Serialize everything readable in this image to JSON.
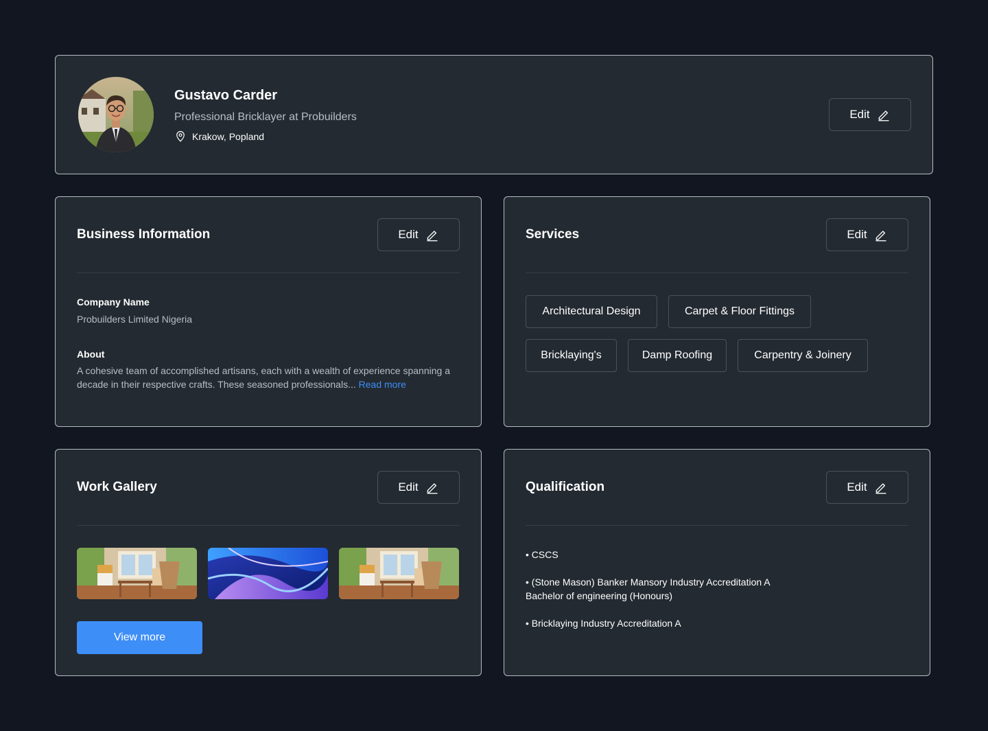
{
  "profile": {
    "name": "Gustavo Carder",
    "title": "Professional Bricklayer at Probuilders",
    "location": "Krakow, Popland",
    "edit_label": "Edit"
  },
  "business": {
    "title": "Business Information",
    "edit_label": "Edit",
    "company_label": "Company Name",
    "company_value": "Probuilders Limited Nigeria",
    "about_label": "About",
    "about_text": "A cohesive team of accomplished artisans, each with a wealth of experience spanning a decade in their respective crafts. These seasoned professionals... ",
    "read_more": "Read more"
  },
  "services": {
    "title": "Services",
    "edit_label": "Edit",
    "tags": [
      "Architectural Design",
      "Carpet & Floor Fittings",
      "Bricklaying's",
      "Damp Roofing",
      "Carpentry & Joinery"
    ]
  },
  "gallery": {
    "title": "Work Gallery",
    "edit_label": "Edit",
    "view_more": "View more"
  },
  "qualification": {
    "title": "Qualification",
    "edit_label": "Edit",
    "items": [
      "• CSCS",
      "• (Stone Mason) Banker Mansory Industry Accreditation A Bachelor of engineering (Honours)",
      "• Bricklaying Industry Accreditation A"
    ]
  },
  "colors": {
    "background": "#111620",
    "card": "#232a31",
    "accent": "#3e8ef7",
    "muted_text": "#b9bec4"
  }
}
